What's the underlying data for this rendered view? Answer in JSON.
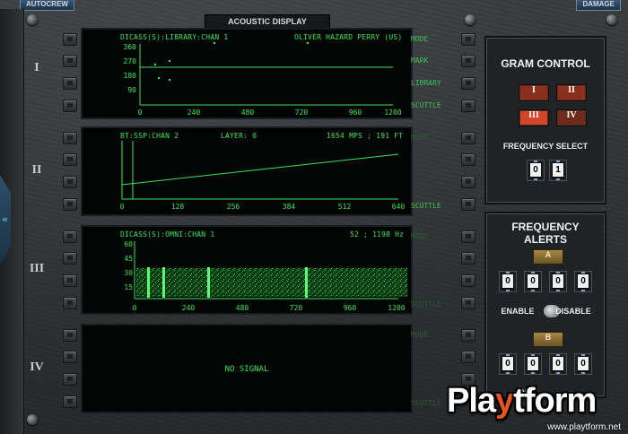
{
  "header": {
    "autocrew_label": "AUTOCREW",
    "damage_label": "DAMAGE",
    "title": "ACOUSTIC DISPLAY"
  },
  "rows": [
    {
      "label": "I"
    },
    {
      "label": "II"
    },
    {
      "label": "III"
    },
    {
      "label": "IV"
    }
  ],
  "screens": [
    {
      "header_left": "DICASS(S):LIBRARY:CHAN 1",
      "header_right": "OLIVER HAZARD PERRY (US)",
      "side_labels": [
        "MODE",
        "MARK",
        "LIBRARY",
        "SCUTTLE"
      ],
      "y_ticks": [
        "360",
        "270",
        "180",
        "90"
      ],
      "x_ticks": [
        "0",
        "240",
        "480",
        "720",
        "960",
        "1200"
      ]
    },
    {
      "header_left": "BT:SSP:CHAN 2",
      "header_mid": "LAYER: 0",
      "header_right": "1654 MPS ; 191 FT",
      "side_labels": [
        "MODE",
        "SCUTTLE"
      ],
      "x_ticks": [
        "0",
        "128",
        "256",
        "384",
        "512",
        "640"
      ]
    },
    {
      "header_left": "DICASS(S):OMNI:CHAN 1",
      "header_right": "52 ; 1198 Hz",
      "side_labels": [
        "MODE",
        "SCUTTLE"
      ],
      "y_ticks": [
        "60",
        "45",
        "30",
        "15"
      ],
      "x_ticks": [
        "0",
        "240",
        "480",
        "720",
        "960",
        "1200"
      ]
    },
    {
      "message": "NO SIGNAL",
      "side_labels": [
        "MODE",
        "SCUTTLE"
      ]
    }
  ],
  "gram_control": {
    "title": "GRAM CONTROL",
    "buttons": [
      "I",
      "II",
      "III",
      "IV"
    ],
    "frequency_select_label": "FREQUENCY SELECT",
    "frequency_digits": [
      "0",
      "1"
    ]
  },
  "frequency_alerts": {
    "title_line1": "FREQUENCY",
    "title_line2": "ALERTS",
    "alert_a": {
      "label": "A",
      "digits": [
        "0",
        "0",
        "0",
        "0"
      ]
    },
    "enable_label": "ENABLE",
    "disable_label": "DISABLE",
    "alert_b": {
      "label": "B",
      "digits": [
        "0",
        "0",
        "0",
        "0"
      ]
    },
    "partial_enable_label": "ENA"
  },
  "watermark": {
    "url": "www.playtform.net"
  },
  "colors": {
    "phosphor_green": "#3ee45a",
    "gram_button_red": "#8a2f1c",
    "gram_button_active": "#d2452a",
    "alert_badge_gold": "#a88845"
  }
}
